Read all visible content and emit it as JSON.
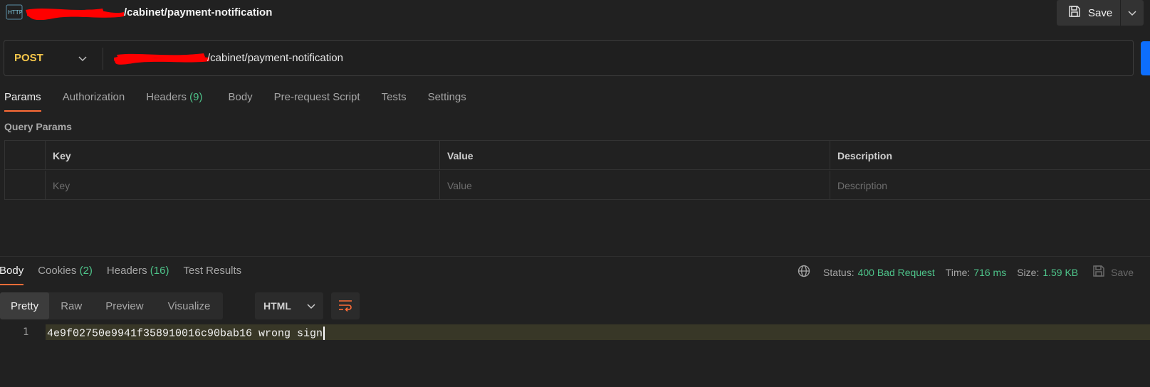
{
  "titlebar": {
    "request_title": "/cabinet/payment-notification",
    "http_icon": "http-icon",
    "save_label": "Save",
    "redaction_color": "#ff0000"
  },
  "urlbar": {
    "method": "POST",
    "url": "/cabinet/payment-notification",
    "method_color": "#f5c64a",
    "send_color": "#0d6efd"
  },
  "request_tabs": [
    {
      "label": "Params",
      "count": ""
    },
    {
      "label": "Authorization",
      "count": ""
    },
    {
      "label": "Headers",
      "count": "(9)"
    },
    {
      "label": "Body",
      "count": ""
    },
    {
      "label": "Pre-request Script",
      "count": ""
    },
    {
      "label": "Tests",
      "count": ""
    },
    {
      "label": "Settings",
      "count": ""
    }
  ],
  "query_params": {
    "label": "Query Params",
    "headers": [
      "Key",
      "Value",
      "Description"
    ],
    "placeholders": [
      "Key",
      "Value",
      "Description"
    ]
  },
  "response": {
    "tabs": [
      {
        "label": "Body",
        "count": ""
      },
      {
        "label": "Cookies",
        "count": "(2)"
      },
      {
        "label": "Headers",
        "count": "(16)"
      },
      {
        "label": "Test Results",
        "count": ""
      }
    ],
    "status_label": "Status:",
    "status_value": "400 Bad Request",
    "time_label": "Time:",
    "time_value": "716 ms",
    "size_label": "Size:",
    "size_value": "1.59 KB",
    "save_label": "Save",
    "formats": [
      "Pretty",
      "Raw",
      "Preview",
      "Visualize"
    ],
    "language": "HTML",
    "line_number": "1",
    "body_text": "4e9f02750e9941f358910016c90bab16 wrong sign",
    "accent_color": "#ff6c37",
    "success_color": "#4ec48a"
  }
}
